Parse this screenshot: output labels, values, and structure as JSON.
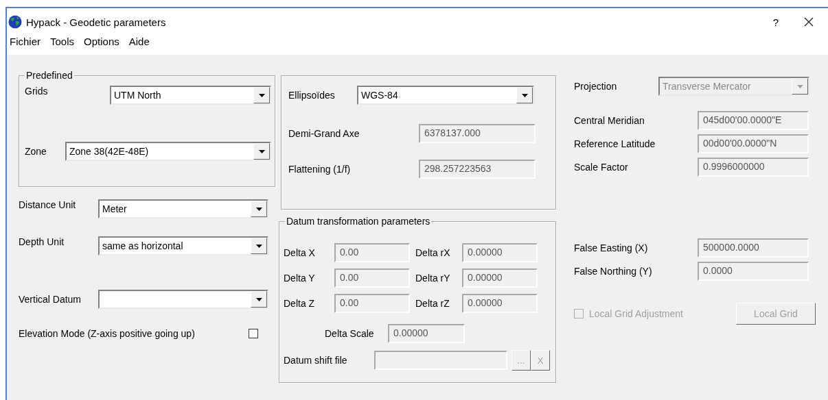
{
  "window": {
    "title": "Hypack - Geodetic parameters",
    "help": "?"
  },
  "menu": [
    "Fichier",
    "Tools",
    "Options",
    "Aide"
  ],
  "predefined": {
    "title": "Predefined",
    "grids": {
      "label": "Grids",
      "value": "UTM North"
    },
    "zone": {
      "label": "Zone",
      "value": "Zone 38(42E-48E)"
    }
  },
  "distance_unit": {
    "label": "Distance Unit",
    "value": "Meter"
  },
  "depth_unit": {
    "label": "Depth Unit",
    "value": "same as horizontal"
  },
  "vertical_datum": {
    "label": "Vertical Datum"
  },
  "elevation_mode": {
    "label": "Elevation Mode (Z-axis positive going up)",
    "checked": false
  },
  "ellipsoid": {
    "label": "Ellipsoïdes",
    "value": "WGS-84"
  },
  "ellipsoid_params": [
    {
      "label": "Demi-Grand Axe",
      "value": "6378137.000"
    },
    {
      "label": "Flattening (1/f)",
      "value": "298.257223563"
    }
  ],
  "datum": {
    "title": "Datum transformation parameters",
    "rows": [
      [
        {
          "label": "Delta X",
          "value": "0.00"
        },
        {
          "label": "Delta rX",
          "value": "0.00000"
        }
      ],
      [
        {
          "label": "Delta Y",
          "value": "0.00"
        },
        {
          "label": "Delta rY",
          "value": "0.00000"
        }
      ],
      [
        {
          "label": "Delta Z",
          "value": "0.00"
        },
        {
          "label": "Delta rZ",
          "value": "0.00000"
        }
      ]
    ],
    "delta_scale": {
      "label": "Delta Scale",
      "value": "0.00000"
    },
    "shift_file": {
      "label": "Datum shift file",
      "browse": "...",
      "clear": "X",
      "disabled": true
    }
  },
  "projection": {
    "label": "Projection",
    "value": "Transverse Mercator",
    "disabled": true
  },
  "projection_params": [
    {
      "label": "Central Meridian",
      "value": "045d00'00.0000\"E"
    },
    {
      "label": "Reference Latitude",
      "value": "00d00'00.0000\"N"
    },
    {
      "label": "Scale Factor",
      "value": "0.9996000000"
    }
  ],
  "false_origin": [
    {
      "label": "False Easting (X)",
      "value": "500000.0000"
    },
    {
      "label": "False Northing (Y)",
      "value": "0.0000"
    }
  ],
  "local_grid": {
    "label": "Local Grid Adjustment",
    "checked": false,
    "disabled": true,
    "button": "Local Grid"
  }
}
